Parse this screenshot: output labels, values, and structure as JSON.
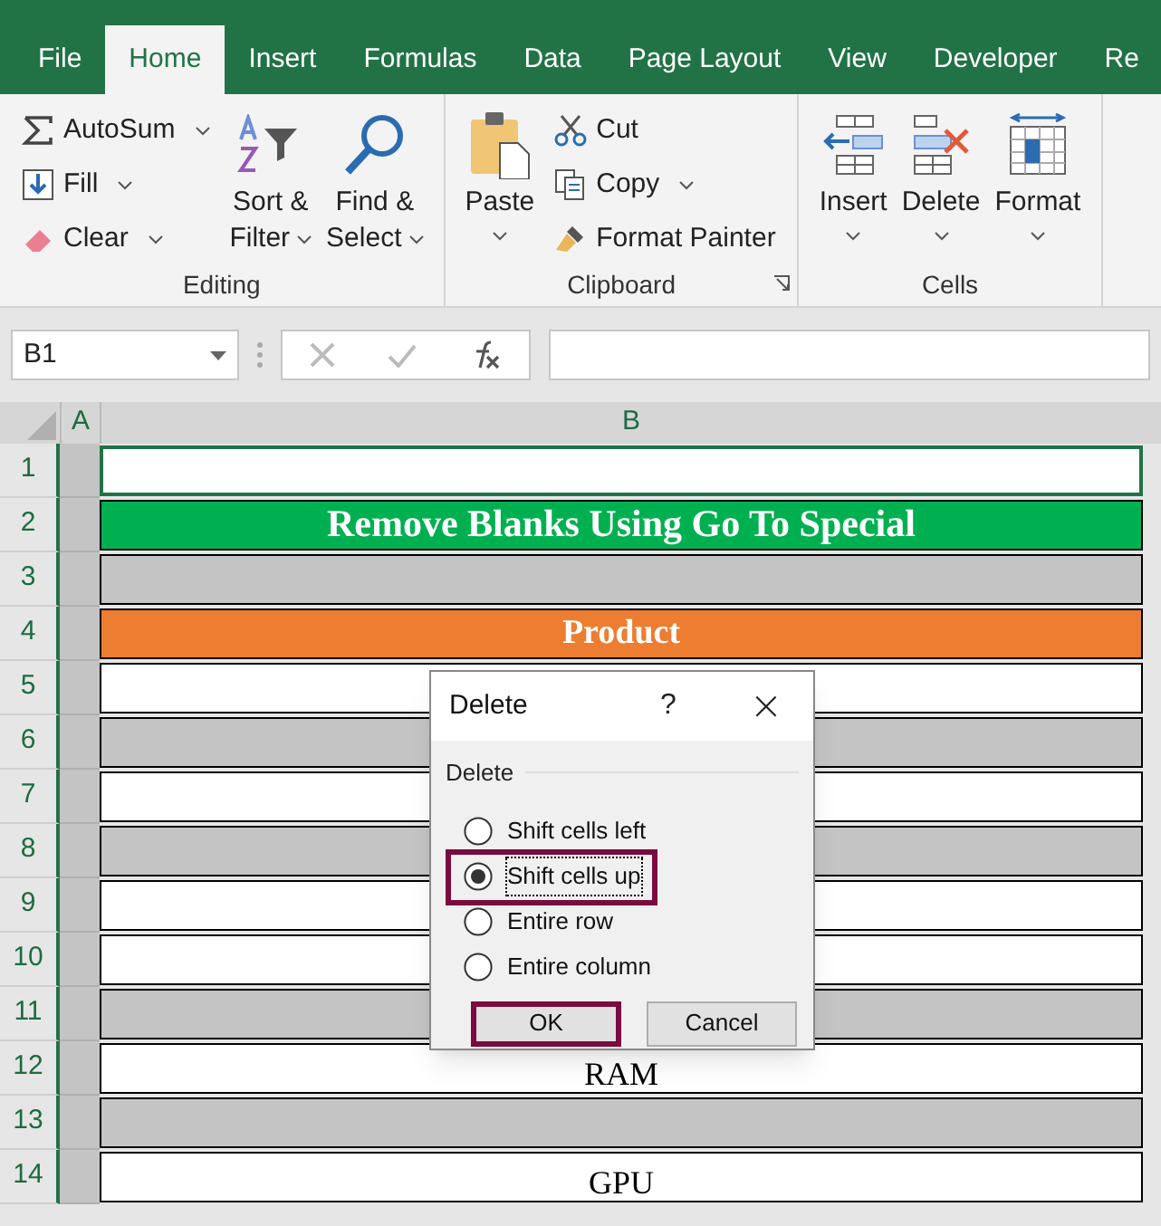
{
  "tabs": [
    {
      "label": "File",
      "selected": false
    },
    {
      "label": "Home",
      "selected": true
    },
    {
      "label": "Insert",
      "selected": false
    },
    {
      "label": "Formulas",
      "selected": false
    },
    {
      "label": "Data",
      "selected": false
    },
    {
      "label": "Page Layout",
      "selected": false
    },
    {
      "label": "View",
      "selected": false
    },
    {
      "label": "Developer",
      "selected": false
    },
    {
      "label": "Re",
      "selected": false
    }
  ],
  "ribbon": {
    "groups": [
      {
        "label": "Editing",
        "small_buttons": [
          {
            "label": "AutoSum",
            "dropdown": true
          },
          {
            "label": "Fill",
            "dropdown": true
          },
          {
            "label": "Clear",
            "dropdown": true
          }
        ],
        "large_buttons": [
          {
            "lines": [
              "Sort &",
              "Filter"
            ],
            "dropdown": true
          },
          {
            "lines": [
              "Find &",
              "Select"
            ],
            "dropdown": true
          }
        ]
      },
      {
        "label": "Clipboard",
        "dialog_launcher": true,
        "large_buttons": [
          {
            "lines": [
              "Paste"
            ],
            "dropdown": true
          }
        ],
        "small_buttons": [
          {
            "label": "Cut"
          },
          {
            "label": "Copy",
            "dropdown": true
          },
          {
            "label": "Format Painter"
          }
        ]
      },
      {
        "label": "Cells",
        "large_buttons": [
          {
            "lines": [
              "Insert"
            ],
            "dropdown": true
          },
          {
            "lines": [
              "Delete"
            ],
            "dropdown": true
          },
          {
            "lines": [
              "Format"
            ],
            "dropdown": true
          }
        ]
      }
    ]
  },
  "name_box": "B1",
  "columns": [
    "A",
    "B"
  ],
  "rows": [
    {
      "number": "1",
      "kind": "selected"
    },
    {
      "number": "2",
      "kind": "title",
      "text": "Remove Blanks Using Go To Special"
    },
    {
      "number": "3",
      "kind": "blank"
    },
    {
      "number": "4",
      "kind": "header",
      "text": "Product"
    },
    {
      "number": "5",
      "kind": "data"
    },
    {
      "number": "6",
      "kind": "blank"
    },
    {
      "number": "7",
      "kind": "data"
    },
    {
      "number": "8",
      "kind": "blank"
    },
    {
      "number": "9",
      "kind": "data"
    },
    {
      "number": "10",
      "kind": "data"
    },
    {
      "number": "11",
      "kind": "blank"
    },
    {
      "number": "12",
      "kind": "data",
      "text": "RAM"
    },
    {
      "number": "13",
      "kind": "blank"
    },
    {
      "number": "14",
      "kind": "data",
      "text": "GPU"
    }
  ],
  "dialog": {
    "title": "Delete",
    "help": "?",
    "close": "×",
    "group_label": "Delete",
    "options": [
      {
        "label": "Shift cells left",
        "selected": false,
        "highlighted": false
      },
      {
        "label": "Shift cells up",
        "selected": true,
        "highlighted": true
      },
      {
        "label": "Entire row",
        "selected": false,
        "highlighted": false
      },
      {
        "label": "Entire column",
        "selected": false,
        "highlighted": false
      }
    ],
    "buttons": [
      {
        "label": "OK",
        "highlighted": true
      },
      {
        "label": "Cancel",
        "highlighted": false
      }
    ]
  }
}
